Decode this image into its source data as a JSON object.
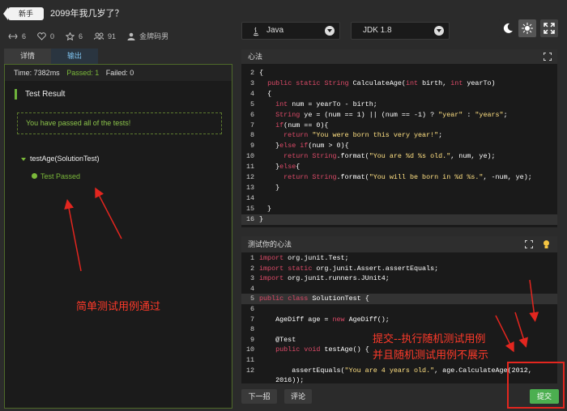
{
  "header": {
    "badge": "新手",
    "title": "2099年我几岁了？",
    "stats": {
      "forks": "6",
      "likes": "0",
      "stars": "6",
      "users": "91",
      "author": "金牌码男"
    }
  },
  "selectors": {
    "language": "Java",
    "jdk": "JDK 1.8"
  },
  "left_tabs": [
    {
      "label": "详情"
    },
    {
      "label": "输出"
    }
  ],
  "result": {
    "time": "Time: 7382ms",
    "passed": "Passed: 1",
    "failed": "Failed: 0",
    "heading": "Test Result",
    "message": "You have passed all of the tests!",
    "suite": "testAge(SolutionTest)",
    "test_status": "Test Passed"
  },
  "annotations": {
    "simple_passed": "简单测试用例通过",
    "submit_line1": "提交--执行随机测试用例",
    "submit_line2": "并且随机测试用例不展示"
  },
  "solution_panel": {
    "title": "心法",
    "lines": [
      {
        "n": "2",
        "c": "{"
      },
      {
        "n": "3",
        "c": "  public static String CalculateAge(int birth, int yearTo)"
      },
      {
        "n": "4",
        "c": "  {"
      },
      {
        "n": "5",
        "c": "    int num = yearTo - birth;"
      },
      {
        "n": "6",
        "c": "    String ye = (num == 1) || (num == -1) ? \"year\" : \"years\";"
      },
      {
        "n": "7",
        "c": "    if(num == 0){"
      },
      {
        "n": "8",
        "c": "      return \"You were born this very year!\";"
      },
      {
        "n": "9",
        "c": "    }else if(num > 0){"
      },
      {
        "n": "10",
        "c": "      return String.format(\"You are %d %s old.\", num, ye);"
      },
      {
        "n": "11",
        "c": "    }else{"
      },
      {
        "n": "12",
        "c": "      return String.format(\"You will be born in %d %s.\", -num, ye);"
      },
      {
        "n": "13",
        "c": "    }"
      },
      {
        "n": "14",
        "c": ""
      },
      {
        "n": "15",
        "c": "  }"
      },
      {
        "n": "16",
        "c": "}"
      }
    ]
  },
  "test_panel": {
    "title": "测试你的心法",
    "lines": [
      {
        "n": "1",
        "c": "import org.junit.Test;"
      },
      {
        "n": "2",
        "c": "import static org.junit.Assert.assertEquals;"
      },
      {
        "n": "3",
        "c": "import org.junit.runners.JUnit4;"
      },
      {
        "n": "4",
        "c": ""
      },
      {
        "n": "5",
        "c": "public class SolutionTest {"
      },
      {
        "n": "6",
        "c": ""
      },
      {
        "n": "7",
        "c": "    AgeDiff age = new AgeDiff();"
      },
      {
        "n": "8",
        "c": ""
      },
      {
        "n": "9",
        "c": "    @Test"
      },
      {
        "n": "10",
        "c": "    public void testAge() {"
      },
      {
        "n": "11",
        "c": ""
      },
      {
        "n": "12",
        "c": "        assertEquals(\"You are 4 years old.\", age.CalculateAge(2012,"
      },
      {
        "n": "",
        "c": "    2016));"
      }
    ]
  },
  "buttons": {
    "next": "下一招",
    "comment": "评论",
    "submit": "提交"
  },
  "colors": {
    "accent_green": "#4caf50",
    "annotation_red": "#ff3a2a",
    "keyword": "#dd4a68",
    "string": "#ffe082"
  }
}
